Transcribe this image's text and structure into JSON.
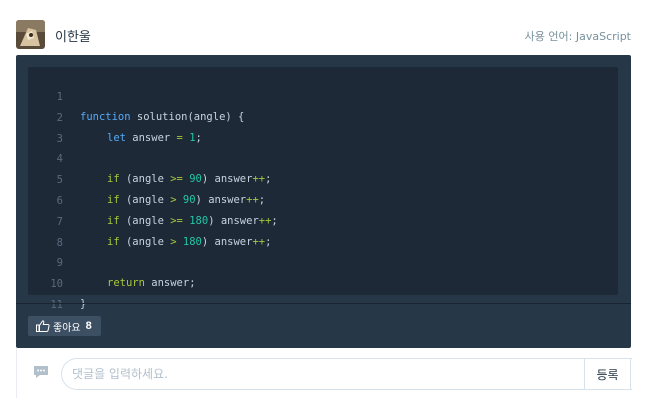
{
  "header": {
    "username": "이한울",
    "language_label": "사용 언어: JavaScript"
  },
  "code": {
    "lines": [
      {
        "n": "1"
      },
      {
        "n": "2"
      },
      {
        "n": "3"
      },
      {
        "n": "4"
      },
      {
        "n": "5"
      },
      {
        "n": "6"
      },
      {
        "n": "7"
      },
      {
        "n": "8"
      },
      {
        "n": "9"
      },
      {
        "n": "10"
      },
      {
        "n": "11"
      }
    ],
    "tokens": {
      "l1_kw": "function",
      "l1_rest": " solution(angle) {",
      "l2_kw": "let",
      "l2_mid": " answer ",
      "l2_op": "=",
      "l2_sp": " ",
      "l2_num": "1",
      "l2_end": ";",
      "if": "if",
      "l4_a": " (angle ",
      "l4_op": ">=",
      "l4_num": "90",
      "l4_b": ") answer",
      "l4_inc": "++",
      "semi": ";",
      "l5_a": " (angle ",
      "l5_op": ">",
      "l5_num": "90",
      "l5_b": ") answer",
      "l6_a": " (angle ",
      "l6_op": ">=",
      "l6_num": "180",
      "l6_b": ") answer",
      "l7_a": " (angle ",
      "l7_op": ">",
      "l7_num": "180",
      "l7_b": ") answer",
      "l9_kw": "return",
      "l9_rest": " answer;",
      "l10": "}"
    }
  },
  "like": {
    "label": "좋아요",
    "count": "8"
  },
  "comment": {
    "placeholder": "댓글을 입력하세요.",
    "submit_label": "등록"
  },
  "colors": {
    "panel": "#263747",
    "code_bg": "#1e2938",
    "keyword": "#57a9f5",
    "number": "#22c6a5",
    "operator": "#a7c83b"
  }
}
